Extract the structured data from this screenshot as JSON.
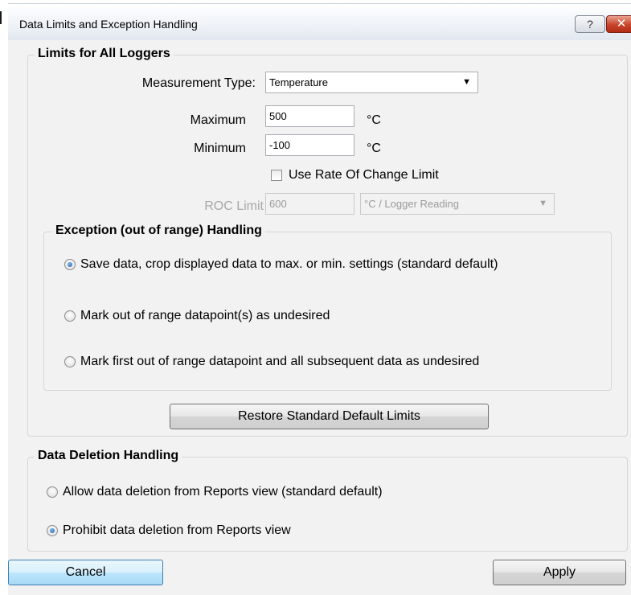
{
  "window": {
    "title": "Data Limits and Exception Handling",
    "help_label": "?",
    "close_label": "✕"
  },
  "limits": {
    "group_title": "Limits for All Loggers",
    "measurement_type_label": "Measurement Type:",
    "measurement_type_value": "Temperature",
    "maximum_label": "Maximum",
    "maximum_value": "500",
    "minimum_label": "Minimum",
    "minimum_value": "-100",
    "unit": "°C",
    "roc_checkbox_label": "Use Rate Of Change Limit",
    "roc_checked": false,
    "roc_limit_label": "ROC Limit",
    "roc_limit_value": "600",
    "roc_unit_value": "°C / Logger Reading",
    "restore_button_label": "Restore Standard Default Limits"
  },
  "exception": {
    "group_title": "Exception (out of range) Handling",
    "options": [
      {
        "label": "Save data, crop displayed data to max. or min. settings (standard default)",
        "selected": true
      },
      {
        "label": "Mark out of range datapoint(s)  as undesired",
        "selected": false
      },
      {
        "label": "Mark first out of range datapoint and all subsequent data  as undesired",
        "selected": false
      }
    ]
  },
  "deletion": {
    "group_title": "Data Deletion Handling",
    "options": [
      {
        "label": "Allow data deletion from Reports view (standard default)",
        "selected": false
      },
      {
        "label": "Prohibit data deletion from Reports view",
        "selected": true
      }
    ]
  },
  "footer": {
    "cancel_label": "Cancel",
    "apply_label": "Apply"
  },
  "icons": {
    "dropdown": "chevron-down-icon",
    "help": "help-icon",
    "close": "close-icon"
  }
}
